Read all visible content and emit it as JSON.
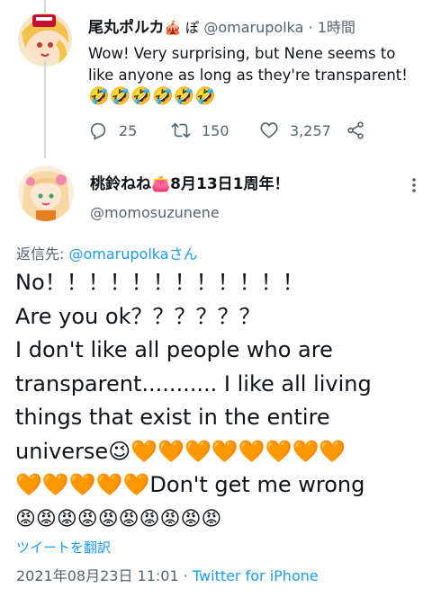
{
  "parent_tweet": {
    "display_name": "尾丸ポルカ",
    "name_badges": "🎪 ぽ",
    "handle": "@omarupolka",
    "separator": " · ",
    "time_ago": "1時間",
    "text": "Wow! Very surprising, but Nene seems to like anyone as long as they're transparent!",
    "emoji_line": "🤣🤣🤣🤣🤣🤣",
    "actions": {
      "reply_count": "25",
      "retweet_count": "150",
      "like_count": "3,257"
    }
  },
  "main_tweet": {
    "display_name": "桃鈴ねね👛8月13日1周年！",
    "handle": "@momosuzunene",
    "replying_prefix": "返信先: ",
    "replying_to": "@omarupolkaさん",
    "lines": [
      "No！！！！！！！！！！！！",
      "Are you ok？？？？？？",
      "I don't like all people who are",
      "transparent........... I like all living",
      "things that exist in the entire",
      "universe😉🧡🧡🧡🧡🧡🧡🧡🧡",
      "🧡🧡🧡🧡🧡Don't get me wrong",
      "😡😡😡😡😡😡😡😡😡😡"
    ],
    "translate_label": "ツイートを翻訳",
    "timestamp": "2021年08月23日 11:01",
    "meta_separator": " · ",
    "source": "Twitter for iPhone"
  },
  "colors": {
    "link": "#1d9bf0",
    "secondary_text": "#536471",
    "thread_line": "#cfd9de"
  }
}
